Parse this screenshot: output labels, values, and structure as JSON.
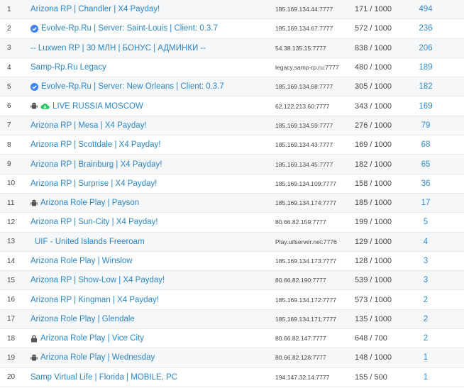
{
  "rows": [
    {
      "num": "1",
      "name": "Arizona RP | Chandler | X4 Payday!",
      "ip": "185.169.134.44:7777",
      "players": "171 / 1000",
      "score": "494",
      "icon": ""
    },
    {
      "num": "2",
      "name": "Evolve-Rp.Ru | Server: Saint-Louis | Client: 0.3.7",
      "ip": "185.169.134.67:7777",
      "players": "572 / 1000",
      "score": "236",
      "icon": "verified-icon"
    },
    {
      "num": "3",
      "name": "-- Luxwen RP | 30 МЛН | БОНУС | АДМИНКИ --",
      "ip": "54.38.135.15:7777",
      "players": "838 / 1000",
      "score": "206",
      "icon": ""
    },
    {
      "num": "4",
      "name": "Samp-Rp.Ru Legacy",
      "ip": "legacy.samp-rp.ru:7777",
      "players": "480 / 1000",
      "score": "189",
      "icon": ""
    },
    {
      "num": "5",
      "name": "Evolve-Rp.Ru | Server: New Orleans | Client: 0.3.7",
      "ip": "185.169.134.68:7777",
      "players": "305 / 1000",
      "score": "182",
      "icon": "verified-icon"
    },
    {
      "num": "6",
      "name": "LIVE RUSSIA MOSCOW",
      "ip": "62.122.213.60:7777",
      "players": "343 / 1000",
      "score": "169",
      "icon": "android-cloud-icon"
    },
    {
      "num": "7",
      "name": "Arizona RP | Mesa | X4 Payday!",
      "ip": "185.169.134.59:7777",
      "players": "276 / 1000",
      "score": "79",
      "icon": ""
    },
    {
      "num": "8",
      "name": "Arizona RP | Scottdale | X4 Payday!",
      "ip": "185.169.134.43:7777",
      "players": "169 / 1000",
      "score": "68",
      "icon": ""
    },
    {
      "num": "9",
      "name": "Arizona RP | Brainburg | X4 Payday!",
      "ip": "185.169.134.45:7777",
      "players": "182 / 1000",
      "score": "65",
      "icon": ""
    },
    {
      "num": "10",
      "name": "Arizona RP | Surprise | X4 Payday!",
      "ip": "185.169.134.109:7777",
      "players": "158 / 1000",
      "score": "36",
      "icon": ""
    },
    {
      "num": "11",
      "name": "Arizona Role Play | Payson",
      "ip": "185.169.134.174:7777",
      "players": "185 / 1000",
      "score": "17",
      "icon": "android-icon"
    },
    {
      "num": "12",
      "name": "Arizona RP | Sun-City | X4 Payday!",
      "ip": "80.66.82.159:7777",
      "players": "199 / 1000",
      "score": "5",
      "icon": ""
    },
    {
      "num": "13",
      "name": "UIF - United Islands Freeroam",
      "ip": "Play.uifserver.net:7776",
      "players": "129 / 1000",
      "score": "4",
      "icon": "",
      "indent": true
    },
    {
      "num": "14",
      "name": "Arizona Role Play | Winslow",
      "ip": "185.169.134.173:7777",
      "players": "128 / 1000",
      "score": "3",
      "icon": ""
    },
    {
      "num": "15",
      "name": "Arizona RP | Show-Low | X4 Payday!",
      "ip": "80.66.82.190:7777",
      "players": "539 / 1000",
      "score": "3",
      "icon": ""
    },
    {
      "num": "16",
      "name": "Arizona RP | Kingman | X4 Payday!",
      "ip": "185.169.134.172:7777",
      "players": "573 / 1000",
      "score": "2",
      "icon": ""
    },
    {
      "num": "17",
      "name": "Arizona Role Play | Glendale",
      "ip": "185.169.134.171:7777",
      "players": "135 / 1000",
      "score": "2",
      "icon": ""
    },
    {
      "num": "18",
      "name": "Arizona Role Play | Vice City",
      "ip": "80.66.82.147:7777",
      "players": "648 / 700",
      "score": "2",
      "icon": "lock-icon"
    },
    {
      "num": "19",
      "name": "Arizona Role Play | Wednesday",
      "ip": "80.66.82.128:7777",
      "players": "148 / 1000",
      "score": "1",
      "icon": "android-icon"
    },
    {
      "num": "20",
      "name": "Samp Virtual Life | Florida | MOBILE, PC",
      "ip": "194.147.32.14:7777",
      "players": "155 / 500",
      "score": "1",
      "icon": ""
    }
  ],
  "colors": {
    "link": "#2a86c8",
    "score": "#2f8fd0",
    "verified": "#3b82f6",
    "cloud": "#22c55e",
    "stripe": "#f6f7f9"
  }
}
